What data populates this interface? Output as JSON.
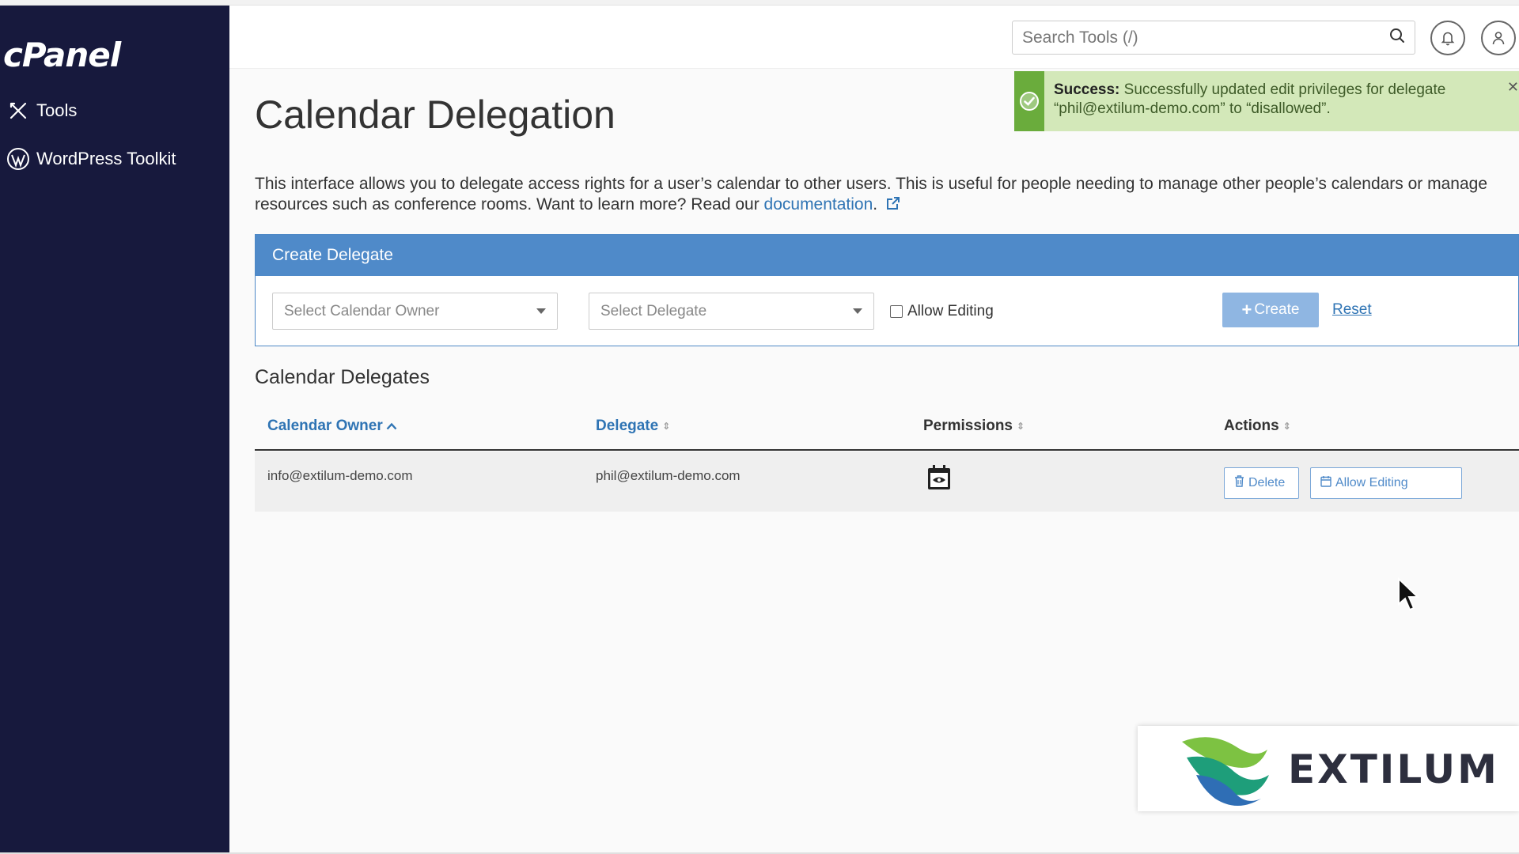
{
  "sidebar": {
    "logo": "cPanel",
    "items": [
      {
        "label": "Tools",
        "icon": "tools-icon"
      },
      {
        "label": "WordPress Toolkit",
        "icon": "wordpress-icon"
      }
    ]
  },
  "header": {
    "search_placeholder": "Search Tools (/)"
  },
  "alert": {
    "strong": "Success:",
    "message": "Successfully updated edit privileges for delegate “phil@extilum-demo.com” to “disallowed”."
  },
  "page": {
    "title": "Calendar Delegation",
    "description_pre": "This interface allows you to delegate access rights for a user’s calendar to other users. This is useful for people needing to manage other people’s calendars or manage resources such as conference rooms. Want to learn more? Read our ",
    "doc_link": "documentation",
    "description_post": "."
  },
  "create": {
    "heading": "Create Delegate",
    "owner_placeholder": "Select Calendar Owner",
    "delegate_placeholder": "Select Delegate",
    "allow_editing": "Allow Editing",
    "create_label": "Create",
    "reset_label": "Reset"
  },
  "delegates": {
    "heading": "Calendar Delegates",
    "columns": [
      "Calendar Owner",
      "Delegate",
      "Permissions",
      "Actions"
    ],
    "rows": [
      {
        "owner": "info@extilum-demo.com",
        "delegate": "phil@extilum-demo.com",
        "permission_icon": "calendar-view-icon",
        "delete_label": "Delete",
        "allow_label": "Allow Editing"
      }
    ]
  },
  "brand": {
    "name": "EXTILUM"
  },
  "colors": {
    "sidebar": "#17193d",
    "accent": "#4f8ac9",
    "success": "#6aac3c"
  }
}
